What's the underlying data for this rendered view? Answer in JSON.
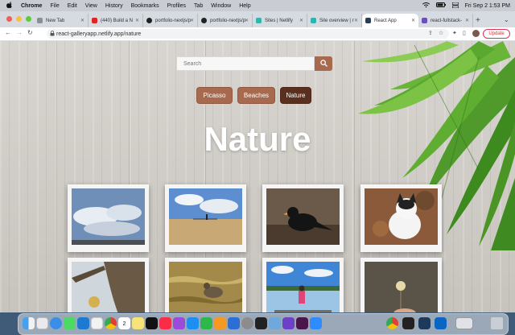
{
  "menubar": {
    "app": "Chrome",
    "items": [
      "File",
      "Edit",
      "View",
      "History",
      "Bookmarks",
      "Profiles",
      "Tab",
      "Window",
      "Help"
    ],
    "datetime": "Fri Sep 2  1:53 PM"
  },
  "tabs": [
    {
      "label": "New Tab",
      "favicon_color": "#8a8f96"
    },
    {
      "label": "(440) Build a N",
      "favicon_color": "#e02424"
    },
    {
      "label": "portfolio-nextjs/p",
      "favicon_color": "#222222"
    },
    {
      "label": "portfolio-nextjs/p",
      "favicon_color": "#222222"
    },
    {
      "label": "Sites | Netlify",
      "favicon_color": "#2fb5ad"
    },
    {
      "label": "Site overview | r",
      "favicon_color": "#2fb5ad"
    },
    {
      "label": "React App",
      "favicon_color": "#2d3e50",
      "active": true
    },
    {
      "label": "react-fullstack-",
      "favicon_color": "#6b4fbb"
    }
  ],
  "toolbar": {
    "url": "react-galleryapp.netlify.app/nature",
    "update_label": "Update"
  },
  "page": {
    "search_placeholder": "Search",
    "categories": [
      {
        "label": "Picasso",
        "active": false
      },
      {
        "label": "Beaches",
        "active": false
      },
      {
        "label": "Nature",
        "active": true
      }
    ],
    "heading": "Nature",
    "accent": "#a86a4e",
    "active_accent": "#5a2f20",
    "photos": [
      "clouds-sky",
      "beach-walker",
      "blackbird",
      "cat-on-leaves",
      "tree-bark",
      "duck-water",
      "girl-lake",
      "hand-dandelion"
    ]
  },
  "dock": {
    "apps": [
      "Finder",
      "Launchpad",
      "Safari",
      "Messages",
      "VS Code",
      "Photos",
      "Chrome",
      "Calendar",
      "Notes",
      "Apple TV",
      "Music",
      "Podcasts",
      "App Store",
      "Numbers",
      "Pages",
      "Keynote",
      "System Settings",
      "Terminal",
      "Preview",
      "GitHub Desktop",
      "Slack",
      "Zoom",
      "Chrome",
      "Terminal",
      "Finder Window",
      "Trash"
    ],
    "calendar_day": "2"
  }
}
